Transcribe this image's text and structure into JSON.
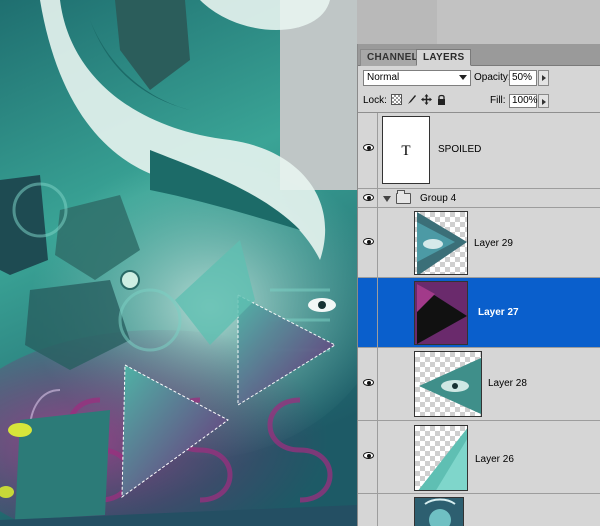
{
  "panel": {
    "tabs": [
      {
        "label": "CHANNELS",
        "active": false
      },
      {
        "label": "LAYERS",
        "active": true
      }
    ],
    "blend_mode": "Normal",
    "opacity_label": "Opacity:",
    "opacity_value": "50%",
    "lock_label": "Lock:",
    "fill_label": "Fill:",
    "fill_value": "100%"
  },
  "layers": [
    {
      "name": "SPOILED",
      "kind": "text",
      "thumb_letter": "T",
      "visible": true,
      "selected": false
    },
    {
      "name": "Group 4",
      "kind": "group",
      "visible": true,
      "expanded": true,
      "selected": false
    },
    {
      "name": "Layer 29",
      "kind": "image",
      "visible": true,
      "selected": false
    },
    {
      "name": "Layer 27",
      "kind": "image",
      "visible": false,
      "selected": true
    },
    {
      "name": "Layer 28",
      "kind": "image",
      "visible": true,
      "selected": false
    },
    {
      "name": "Layer 26",
      "kind": "image",
      "visible": true,
      "selected": false
    },
    {
      "name": "",
      "kind": "image",
      "visible": false,
      "selected": false
    }
  ],
  "colors": {
    "selection": "#0a5fcc",
    "panel_bg": "#d6d6d6",
    "teal": "#2c8a84",
    "magenta": "#8a2a72"
  }
}
